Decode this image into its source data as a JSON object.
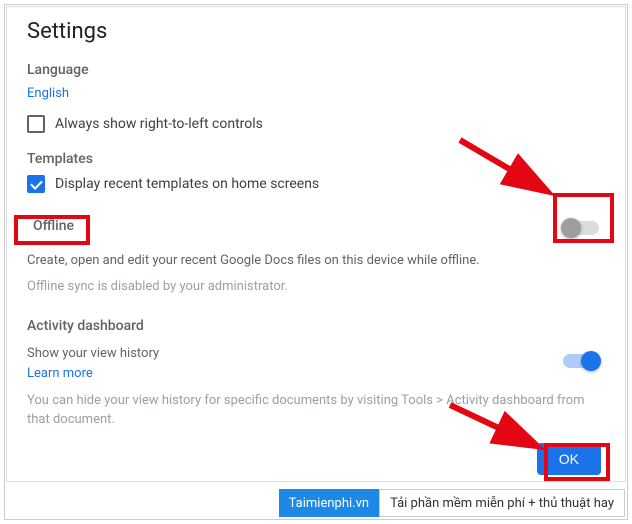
{
  "title": "Settings",
  "language": {
    "header": "Language",
    "value": "English",
    "rtl_checkbox_label": "Always show right-to-left controls",
    "rtl_checked": false
  },
  "templates": {
    "header": "Templates",
    "checkbox_label": "Display recent templates on home screens",
    "checked": true
  },
  "offline": {
    "header": "Offline",
    "desc": "Create, open and edit your recent Google Docs files on this device while offline.",
    "disabled_note": "Offline sync is disabled by your administrator.",
    "toggle_on": false
  },
  "activity": {
    "header": "Activity dashboard",
    "show_history_label": "Show your view history",
    "learn_more": "Learn more",
    "toggle_on": true,
    "note": "You can hide your view history for specific documents by visiting Tools > Activity dashboard from that document."
  },
  "ok_button": "OK",
  "footer": {
    "brand": "Taimienphi.vn",
    "tagline": "Tải phần mềm miễn phí + thủ thuật hay"
  }
}
